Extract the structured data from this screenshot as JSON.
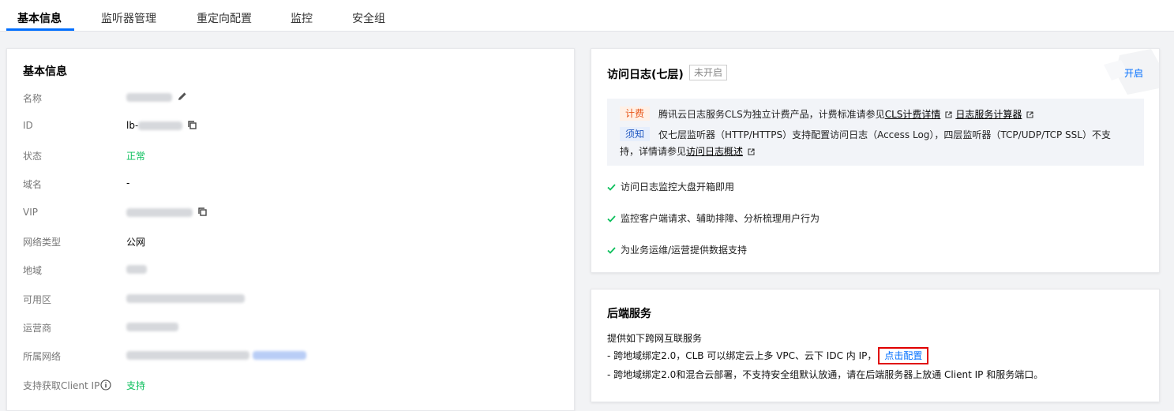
{
  "tabs": [
    {
      "label": "基本信息",
      "active": true
    },
    {
      "label": "监听器管理"
    },
    {
      "label": "重定向配置"
    },
    {
      "label": "监控"
    },
    {
      "label": "安全组"
    }
  ],
  "basic": {
    "title": "基本信息",
    "rows": [
      {
        "label": "名称"
      },
      {
        "label": "ID",
        "value_prefix": "lb-"
      },
      {
        "label": "状态",
        "value": "正常"
      },
      {
        "label": "域名",
        "value": "-"
      },
      {
        "label": "VIP"
      },
      {
        "label": "网络类型",
        "value": "公网"
      },
      {
        "label": "地域"
      },
      {
        "label": "可用区"
      },
      {
        "label": "运营商"
      },
      {
        "label": "所属网络"
      },
      {
        "label": "支持获取Client IP",
        "value": "支持"
      }
    ]
  },
  "access_log": {
    "title": "访问日志(七层)",
    "status_badge": "未开启",
    "enable_link": "开启",
    "fee_tag": "计费",
    "fee_text": "腾讯云日志服务CLS为独立计费产品，计费标准请参见",
    "fee_link1": "CLS计费详情",
    "fee_link2": "日志服务计算器",
    "note_tag": "须知",
    "note_text1": "仅七层监听器（HTTP/HTTPS）支持配置访问日志（Access Log），四层监听器（TCP/UDP/TCP SSL）不支",
    "note_text2": "持，详情请参见",
    "note_link": "访问日志概述",
    "features": [
      "访问日志监控大盘开箱即用",
      "监控客户端请求、辅助排障、分析梳理用户行为",
      "为业务运维/运营提供数据支持"
    ]
  },
  "backend": {
    "title": "后端服务",
    "intro": "提供如下跨网互联服务",
    "line1": "- 跨地域绑定2.0，CLB 可以绑定云上多 VPC、云下 IDC 内 IP，",
    "config_link": "点击配置",
    "line2": "- 跨地域绑定2.0和混合云部署，不支持安全组默认放通，请在后端服务器上放通 Client IP 和服务端口。"
  },
  "colors": {
    "accent": "#006eff",
    "success": "#0abf5b",
    "fee": "#e8581c",
    "highlight": "#e00000"
  }
}
